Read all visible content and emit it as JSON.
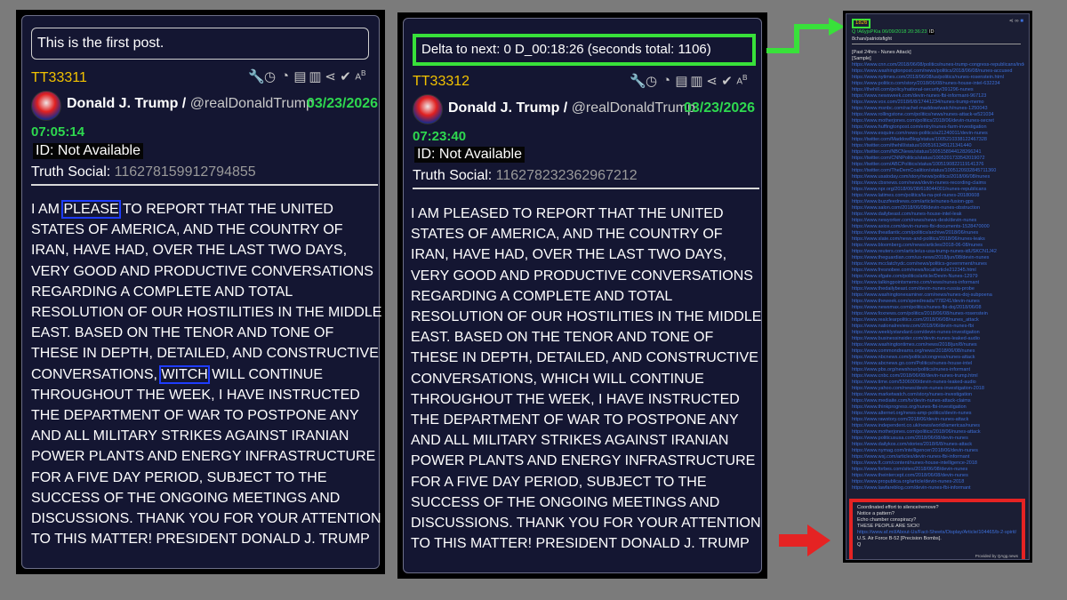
{
  "post1": {
    "first_post_label": "This is the first post.",
    "id_code": "TT33311",
    "author_name": "Donald J. Trump /",
    "author_handle": "@realDonaldTrump",
    "date": "03/23/2026",
    "time": "07:05:14",
    "id_text": "ID: Not Available",
    "ts_label": "Truth Social:",
    "ts_number": "116278159912794855",
    "body_parts": [
      "I AM ",
      "PLEASE",
      " TO REPORT THAT THE UNITED STATES OF AMERICA, AND THE COUNTRY OF IRAN, HAVE HAD, OVER THE LAST TWO DAYS, VERY GOOD AND PRODUCTIVE CONVERSATIONS REGARDING A COMPLETE AND TOTAL RESOLUTION OF OUR HOSTILITIES IN THE MIDDLE EAST. BASED ON THE TENOR AND TONE OF THESE IN DEPTH, DETAILED, AND CONSTRUCTIVE CONVERSATIONS, ",
      "WITCH",
      " WILL CONTINUE THROUGHOUT THE WEEK, I HAVE INSTRUCTED THE DEPARTMENT OF WAR TO POSTPONE ANY AND ALL MILITARY STRIKES AGAINST IRANIAN POWER PLANTS AND ENERGY INFRASTRUCTURE FOR A FIVE DAY PERIOD, SUBJECT TO THE SUCCESS OF THE ONGOING MEETINGS AND DISCUSSIONS. THANK YOU FOR YOUR ATTENTION TO THIS MATTER! PRESIDENT DONALD J. TRUMP"
    ]
  },
  "post2": {
    "delta_label": "Delta to next: 0 D_00:18:26 (seconds total: 1106)",
    "id_code": "TT33312",
    "author_name": "Donald J. Trump /",
    "author_handle": "@realDonaldTrump",
    "date": "03/23/2026",
    "time": "07:23:40",
    "id_text": "ID: Not Available",
    "ts_label": "Truth Social:",
    "ts_number": "116278232362967212",
    "body": "I AM PLEASED TO REPORT THAT THE UNITED STATES OF AMERICA, AND THE COUNTRY OF IRAN, HAVE HAD, OVER THE LAST TWO DAYS, VERY GOOD AND PRODUCTIVE CONVERSATIONS REGARDING A COMPLETE AND TOTAL RESOLUTION OF OUR HOSTILITIES IN THE MIDDLE EAST. BASED ON THE TENOR AND TONE OF THESE IN DEPTH, DETAILED, AND CONSTRUCTIVE CONVERSATIONS, WHICH WILL CONTINUE THROUGHOUT THE WEEK, I HAVE INSTRUCTED THE DEPARTMENT OF WAR TO POSTPONE ANY AND ALL MILITARY STRIKES AGAINST IRANIAN POWER PLANTS AND ENERGY INFRASTRUCTURE FOR A FIVE DAY PERIOD, SUBJECT TO THE SUCCESS OF THE ONGOING MEETINGS AND DISCUSSIONS. THANK YOU FOR YOUR ATTENTION TO THIS MATTER! PRESIDENT DONALD J. TRUMP"
  },
  "qpost": {
    "number": "1826",
    "meta": "Q !A6yjsPKia 06/09/2018 20:36:23",
    "meta_id": "ID",
    "board": "8chan/patriotsfight",
    "heading_lines": [
      "[Past 24hrs - Nunes Attack]",
      "[Sample]"
    ],
    "links": [
      "https://www.cnn.com/2018/06/08/politics/nunes-trump-congress-republicans/index.html",
      "https://www.washingtonpost.com/news/politics/2018/06/08/nunes-accused",
      "https://www.nytimes.com/2018/06/08/us/politics/nunes-rosenstein.html",
      "https://www.politico.com/story/2018/06/08/nunes-house-intel-632234",
      "https://thehill.com/policy/national-security/391296-nunes",
      "https://www.newsweek.com/devin-nunes-fbi-informant-967123",
      "https://www.vox.com/2018/6/8/17441234/nunes-trump-memo",
      "https://www.msnbc.com/rachel-maddow/watch/nunes-1250043",
      "https://www.rollingstone.com/politics/news/nunes-attack-w521034",
      "https://www.motherjones.com/politics/2018/06/devin-nunes-secret",
      "https://www.huffingtonpost.com/entry/nunes-farm-investigation",
      "https://www.esquire.com/news-politics/a21240011/devin-nunes",
      "https://twitter.com/MaddowBlog/status/1005210338122467328",
      "https://twitter.com/thehill/status/1005161345121341440",
      "https://twitter.com/NBCNews/status/1005158944128266241",
      "https://twitter.com/CNNPolitics/status/1005201733542019072",
      "https://twitter.com/ABCPolitics/status/1005190822119141376",
      "https://twitter.com/TheDemCoalition/status/1005120932845711360",
      "https://www.usatoday.com/story/news/politics/2018/06/08/nunes",
      "https://www.cbsnews.com/news/devin-nunes-recording-claims",
      "https://www.npr.org/2018/06/08/618044001/nunes-republicans",
      "https://www.latimes.com/politics/la-na-pol-nunes-20180608",
      "https://www.buzzfeednews.com/article/nunes-fusion-gps",
      "https://www.salon.com/2018/06/08/devin-nunes-obstruction",
      "https://www.dailybeast.com/nunes-house-intel-leak",
      "https://www.newyorker.com/news/news-desk/devin-nunes",
      "https://www.axios.com/devin-nunes-fbi-documents-1528470000",
      "https://www.theatlantic.com/politics/archive/2018/06/nunes",
      "https://www.slate.com/news-and-politics/2018/06/nunes-leaks",
      "https://www.bloomberg.com/news/articles/2018-06-08/nunes",
      "https://www.reuters.com/article/us-usa-trump-nunes-idUSKCN1J42",
      "https://www.theguardian.com/us-news/2018/jun/08/devin-nunes",
      "https://www.mcclatchydc.com/news/politics-government/nunes",
      "https://www.fresnobee.com/news/local/article212345.html",
      "https://www.sfgate.com/politics/article/Devin-Nunes-12979",
      "https://www.talkingpointsmemo.com/news/nunes-informant",
      "https://www.thedailybeast.com/devin-nunes-russia-probe",
      "https://www.washingtonexaminer.com/news/nunes-doj-subpoena",
      "https://www.theweek.com/speedreads/778241/devin-nunes",
      "https://www.newsmax.com/politics/nunes-fbi-doj/2018/06/08",
      "https://www.foxnews.com/politics/2018/06/08/nunes-rosenstein",
      "https://www.realclearpolitics.com/2018/06/08/nunes_attack",
      "https://www.nationalreview.com/2018/06/devin-nunes-fbi",
      "https://www.weeklystandard.com/devin-nunes-investigation",
      "https://www.businessinsider.com/devin-nunes-leaked-audio",
      "https://www.washingtontimes.com/news/2018/jun/8/nunes",
      "https://www.commondreams.org/news/2018/06/08/nunes",
      "https://www.nbcnews.com/politics/congress/nunes-attack",
      "https://www.abcnews.go.com/Politics/nunes-house-intel",
      "https://www.pbs.org/newshour/politics/nunes-informant",
      "https://www.cnbc.com/2018/06/08/devin-nunes-trump.html",
      "https://www.time.com/5306000/devin-nunes-leaked-audio",
      "https://www.yahoo.com/news/devin-nunes-investigation-2018",
      "https://www.marketwatch.com/story/nunes-investigation",
      "https://www.mediaite.com/tv/devin-nunes-attack-claims",
      "https://www.thinkprogress.org/nunes-fbi-investigation",
      "https://www.alternet.org/news-amp-politics/devin-nunes",
      "https://www.rawstory.com/2018/06/devin-nunes-attack",
      "https://www.independent.co.uk/news/world/americas/nunes",
      "https://www.motherjones.com/politics/2018/06/nunes-attack",
      "https://www.politicususa.com/2018/06/08/devin-nunes",
      "https://www.dailykos.com/stories/2018/6/8/nunes-attack",
      "https://www.nymag.com/intelligencer/2018/06/devin-nunes",
      "https://www.wsj.com/articles/devin-nunes-fbi-informant",
      "https://www.ft.com/content/nunes-house-intelligence-2018",
      "https://www.forbes.com/sites/2018/06/08/devin-nunes",
      "https://www.theintercept.com/2018/06/08/devin-nunes",
      "https://www.propublica.org/article/devin-nunes-2018",
      "https://www.lawfareblog.com/devin-nunes-fbi-informant"
    ],
    "red_lines": [
      "Coordinated effort to silence/remove?",
      "Notice a pattern?",
      "Echo chamber conspiracy?",
      "THESE PEOPLE ARE SICK!"
    ],
    "red_link": "https://www.af.mil/About-Us/Fact-Sheets/Display/Article/104465/b-2-spirit/",
    "red_tail": [
      "U.S. Air Force B-52 [Precision Bombs].",
      "Q"
    ],
    "provider": "Provided by QAgg.news"
  },
  "colors": {
    "accent_green": "#2ed84f",
    "gold": "#f2c200",
    "highlight_blue": "#1e3cff",
    "box_red": "#e52323",
    "box_green": "#38e13a"
  },
  "icons": [
    "wrench-icon",
    "clock-icon",
    "clock-icon",
    "clipboard-icon",
    "clipboard-icon",
    "share-icon",
    "checkmark-circle-icon",
    "translate-icon"
  ]
}
